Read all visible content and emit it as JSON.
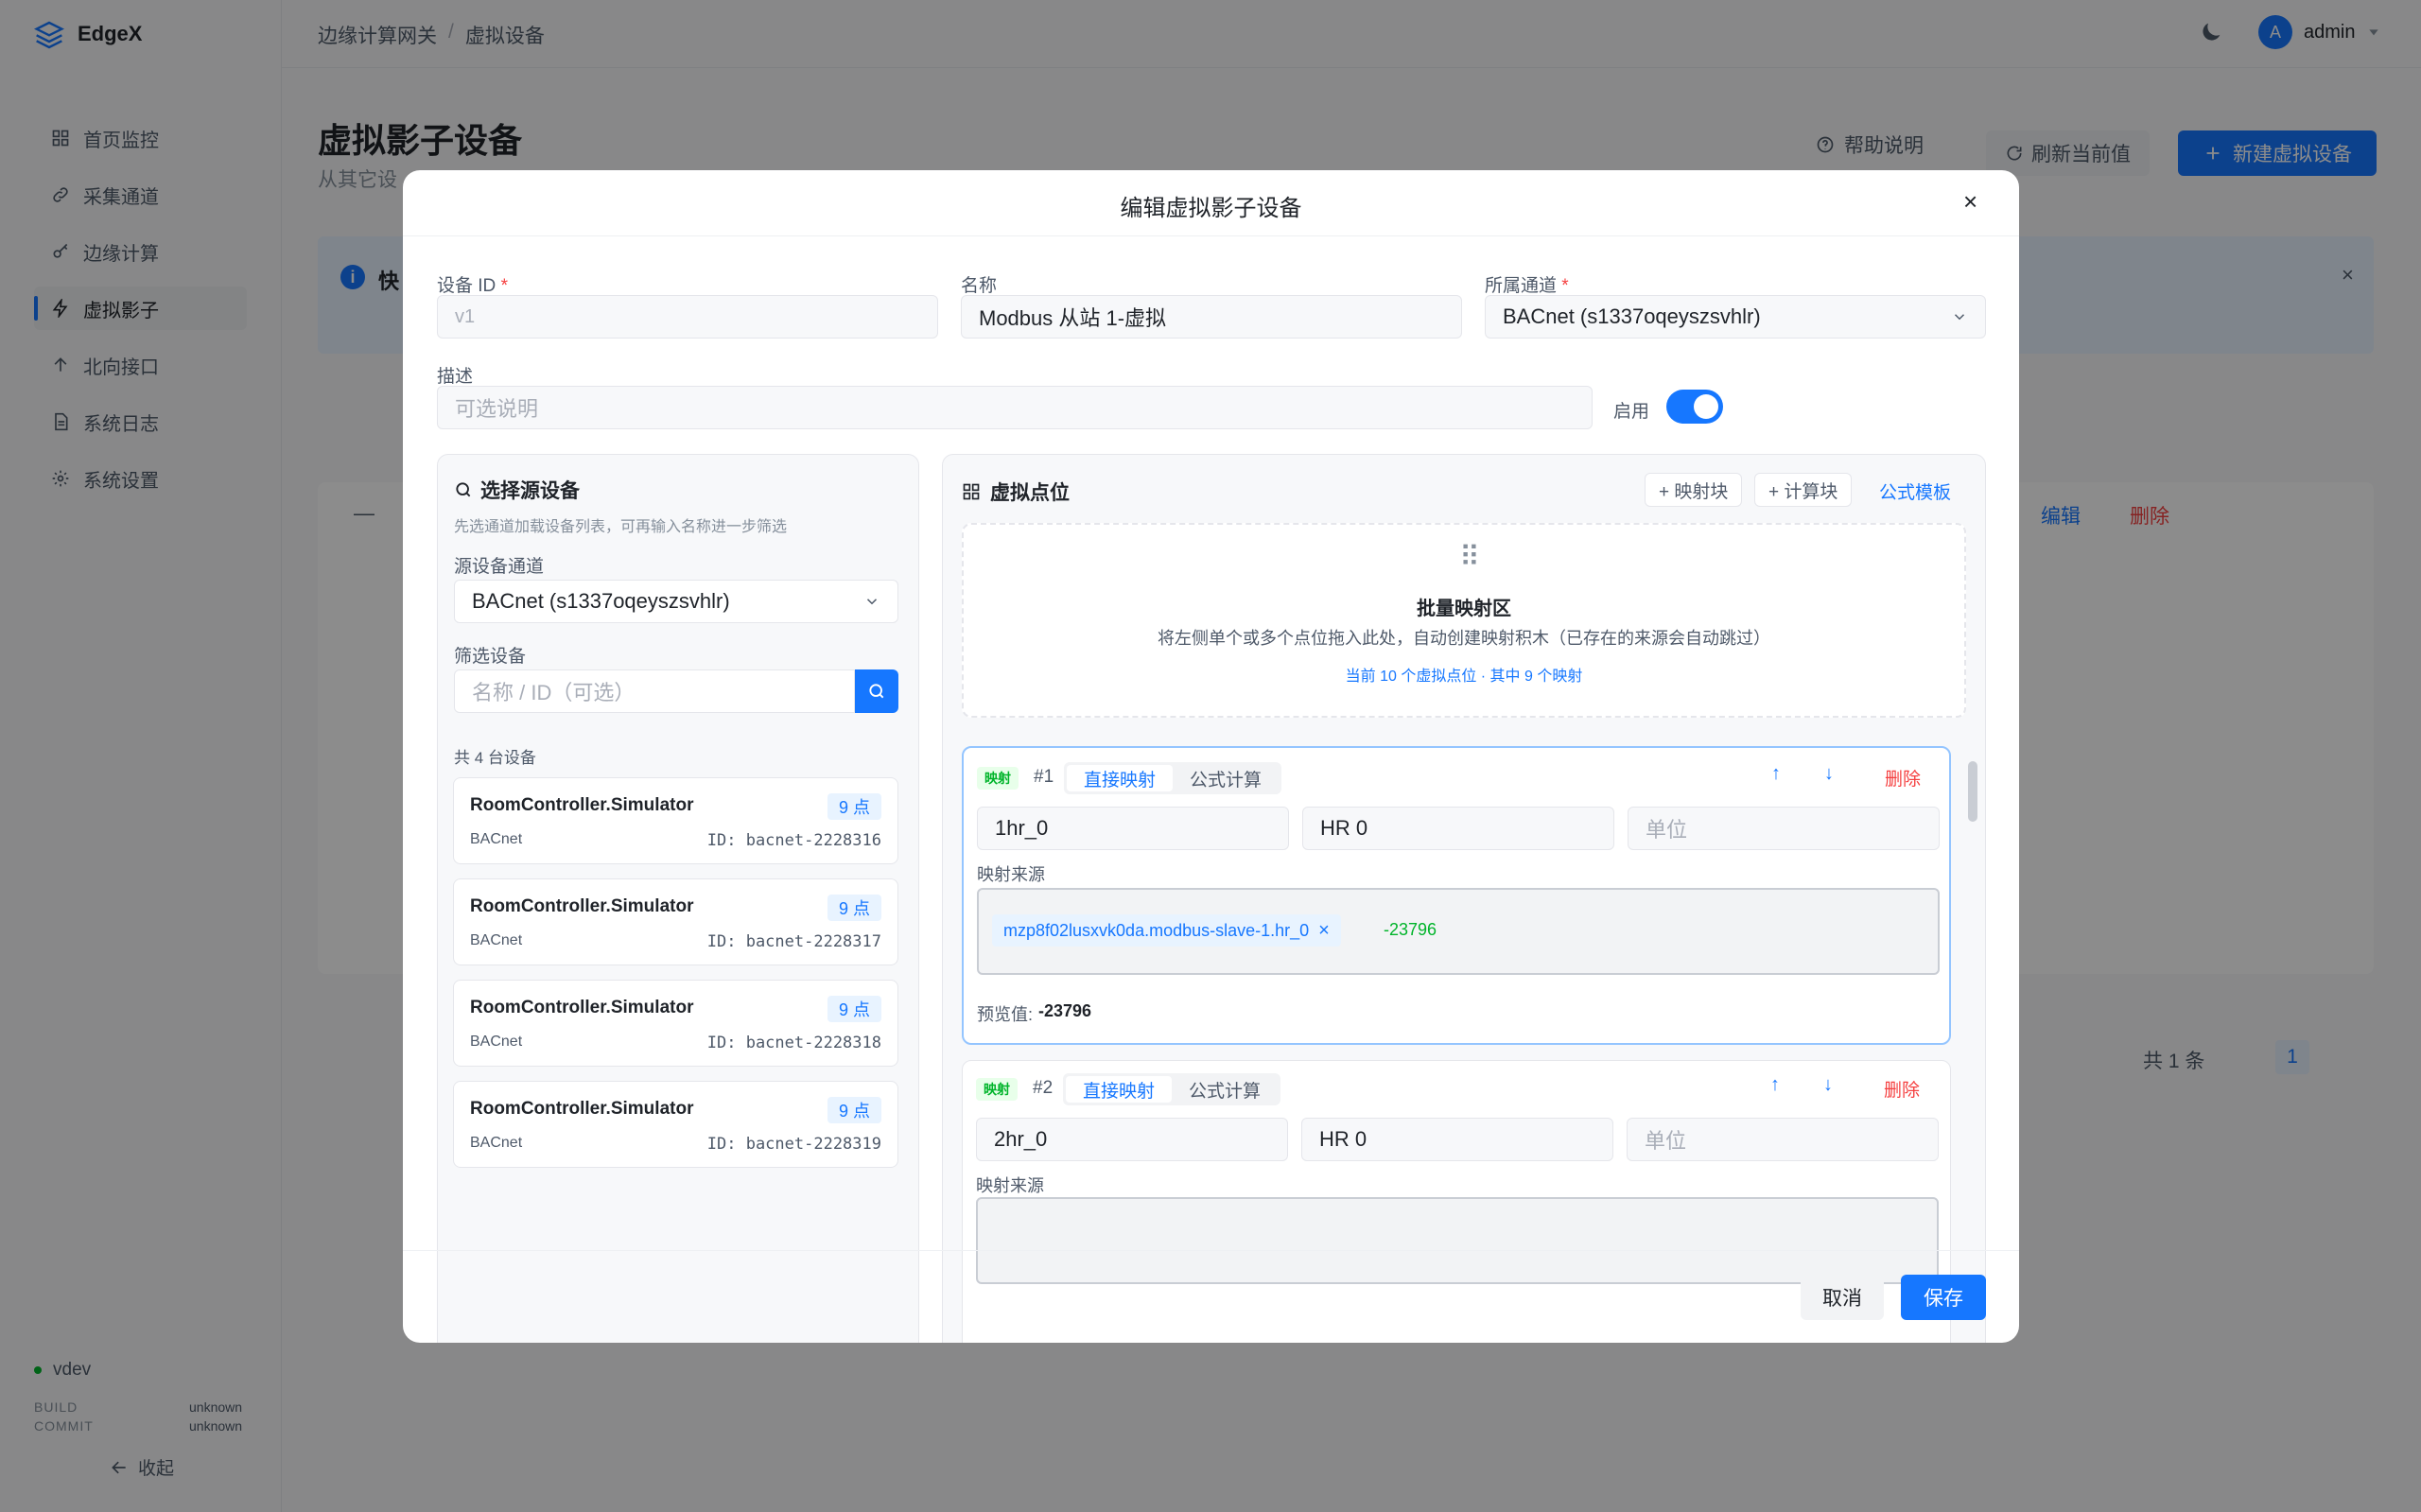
{
  "app": {
    "name": "EdgeX"
  },
  "sidebar": {
    "items": [
      {
        "label": "首页监控",
        "icon": "grid-icon"
      },
      {
        "label": "采集通道",
        "icon": "link-icon"
      },
      {
        "label": "边缘计算",
        "icon": "key-icon"
      },
      {
        "label": "虚拟影子",
        "icon": "bolt-icon"
      },
      {
        "label": "北向接口",
        "icon": "arrow-up-icon"
      },
      {
        "label": "系统日志",
        "icon": "doc-icon"
      },
      {
        "label": "系统设置",
        "icon": "gear-icon"
      }
    ],
    "version": "vdev",
    "build_label": "BUILD",
    "build_value": "unknown",
    "commit_label": "COMMIT",
    "commit_value": "unknown",
    "collapse": "收起"
  },
  "header": {
    "breadcrumb_root": "边缘计算网关",
    "breadcrumb_sep": "/",
    "breadcrumb_current": "虚拟设备",
    "user_initial": "A",
    "user_name": "admin"
  },
  "page": {
    "title": "虚拟影子设备",
    "subtitle": "从其它设",
    "help": "帮助说明",
    "refresh": "刷新当前值",
    "new_device": "新建虚拟设备",
    "alert_title": "快",
    "edit": "编辑",
    "delete": "删除",
    "row_dash": "—",
    "total": "共 1 条",
    "page_num": "1"
  },
  "modal": {
    "title": "编辑虚拟影子设备",
    "device_id_label": "设备 ID",
    "device_id_value": "v1",
    "name_label": "名称",
    "name_value": "Modbus 从站 1-虚拟",
    "channel_label": "所属通道",
    "channel_value": "BACnet (s1337oqeyszsvhlr)",
    "desc_label": "描述",
    "desc_placeholder": "可选说明",
    "enable_label": "启用",
    "enabled": true,
    "cancel": "取消",
    "save": "保存"
  },
  "source_panel": {
    "title": "选择源设备",
    "hint": "先选通道加载设备列表，可再输入名称进一步筛选",
    "channel_label": "源设备通道",
    "channel_value": "BACnet (s1337oqeyszsvhlr)",
    "filter_label": "筛选设备",
    "filter_placeholder": "名称 / ID（可选）",
    "count": "共 4 台设备",
    "devices": [
      {
        "name": "RoomController.Simulator",
        "points": "9 点",
        "protocol": "BACnet",
        "id": "ID: bacnet-2228316"
      },
      {
        "name": "RoomController.Simulator",
        "points": "9 点",
        "protocol": "BACnet",
        "id": "ID: bacnet-2228317"
      },
      {
        "name": "RoomController.Simulator",
        "points": "9 点",
        "protocol": "BACnet",
        "id": "ID: bacnet-2228318"
      },
      {
        "name": "RoomController.Simulator",
        "points": "9 点",
        "protocol": "BACnet",
        "id": "ID: bacnet-2228319"
      }
    ]
  },
  "points_panel": {
    "title": "虚拟点位",
    "add_map": "+ 映射块",
    "add_calc": "+ 计算块",
    "template": "公式模板",
    "drop_title": "批量映射区",
    "drop_desc": "将左侧单个或多个点位拖入此处，自动创建映射积木（已存在的来源会自动跳过）",
    "drop_stats": "当前 10 个虚拟点位 · 其中 9 个映射",
    "blocks": [
      {
        "tag": "映射",
        "index": "#1",
        "mode_direct": "直接映射",
        "mode_formula": "公式计算",
        "name": "1hr_0",
        "label": "HR 0",
        "unit_placeholder": "单位",
        "source_label": "映射来源",
        "source_chip": "mzp8f02lusxvk0da.modbus-slave-1.hr_0",
        "source_value": "-23796",
        "preview_label": "预览值:",
        "preview_value": "-23796",
        "delete": "删除"
      },
      {
        "tag": "映射",
        "index": "#2",
        "mode_direct": "直接映射",
        "mode_formula": "公式计算",
        "name": "2hr_0",
        "label": "HR 0",
        "unit_placeholder": "单位",
        "source_label": "映射来源",
        "delete": "删除"
      }
    ]
  },
  "colors": {
    "primary": "#1677ff",
    "danger": "#f53f3f",
    "success": "#00b42a"
  }
}
